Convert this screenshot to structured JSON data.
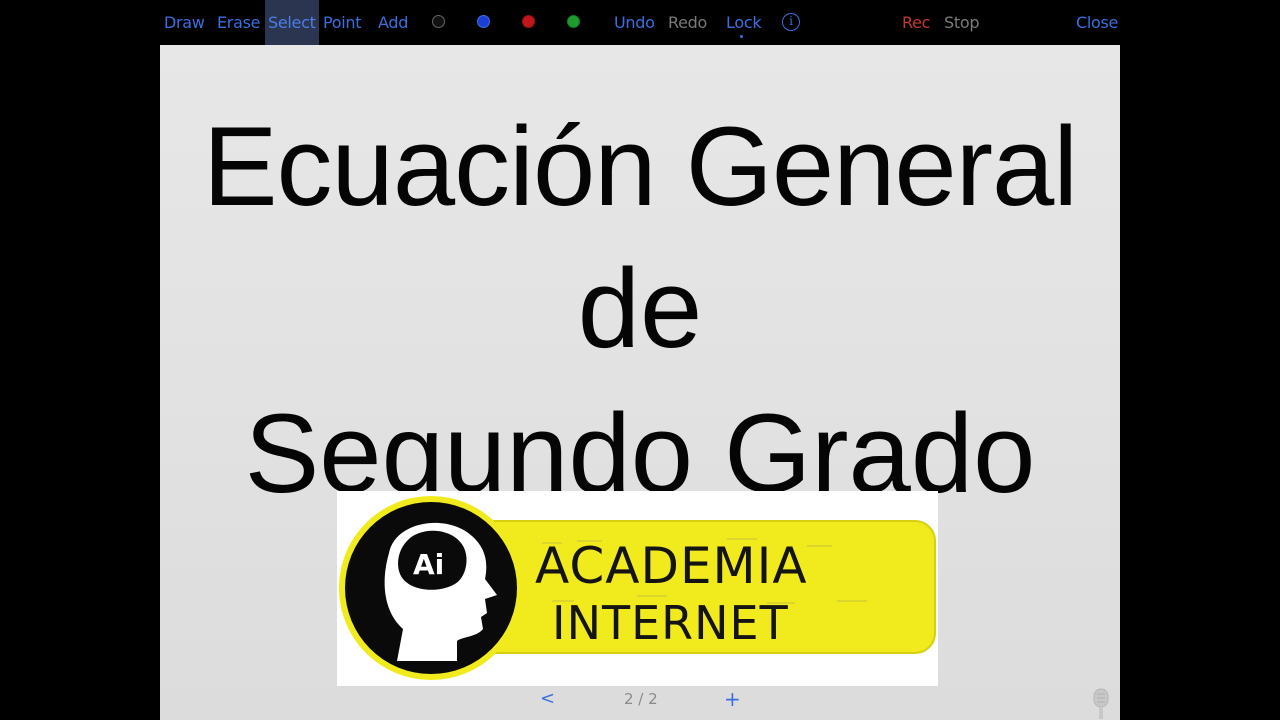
{
  "toolbar": {
    "draw": "Draw",
    "erase": "Erase",
    "select": "Select",
    "point": "Point",
    "add": "Add",
    "colors": [
      "#111111",
      "#1b3fd6",
      "#c0181a",
      "#1f9a2e"
    ],
    "undo": "Undo",
    "redo": "Redo",
    "lock": "Lock",
    "info": "i",
    "rec": "Rec",
    "stop": "Stop",
    "close": "Close"
  },
  "slide": {
    "title_line1": "Ecuación General",
    "title_line2": "de",
    "title_line3": "Segundo Grado",
    "logo": {
      "badge": "Ai",
      "word1": "ACADEMIA",
      "word2": "INTERNET"
    }
  },
  "pager": {
    "prev": "<",
    "count": "2 / 2",
    "next": "+"
  },
  "icons": {
    "info": "info-icon",
    "mic": "microphone-icon"
  }
}
